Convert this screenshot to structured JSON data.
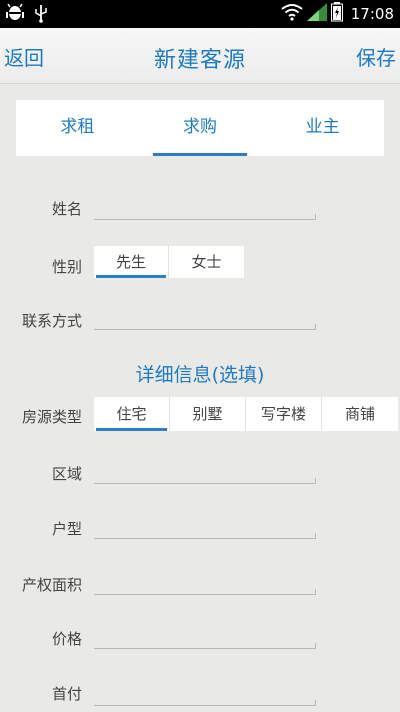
{
  "status_bar": {
    "time": "17:08",
    "icons": [
      "android-debug-icon",
      "usb-icon",
      "wifi-icon",
      "signal-icon",
      "battery-icon"
    ]
  },
  "title_bar": {
    "back_label": "返回",
    "title": "新建客源",
    "save_label": "保存"
  },
  "tabs": [
    {
      "label": "求租",
      "active": false
    },
    {
      "label": "求购",
      "active": true
    },
    {
      "label": "业主",
      "active": false
    }
  ],
  "form": {
    "name_label": "姓名",
    "name_value": "",
    "gender_label": "性别",
    "gender_options": [
      {
        "label": "先生",
        "active": true
      },
      {
        "label": "女士",
        "active": false
      }
    ],
    "contact_label": "联系方式",
    "contact_value": ""
  },
  "details": {
    "section_title": "详细信息(选填)",
    "property_type_label": "房源类型",
    "property_type_options": [
      {
        "label": "住宅",
        "active": true
      },
      {
        "label": "别墅",
        "active": false
      },
      {
        "label": "写字楼",
        "active": false
      },
      {
        "label": "商铺",
        "active": false
      }
    ],
    "area_label": "区域",
    "layout_label": "户型",
    "property_size_label": "产权面积",
    "price_label": "价格",
    "down_payment_label": "首付"
  },
  "colors": {
    "accent": "#1f7bc0",
    "background": "#e9e9e7",
    "status_bar": "#000000"
  }
}
